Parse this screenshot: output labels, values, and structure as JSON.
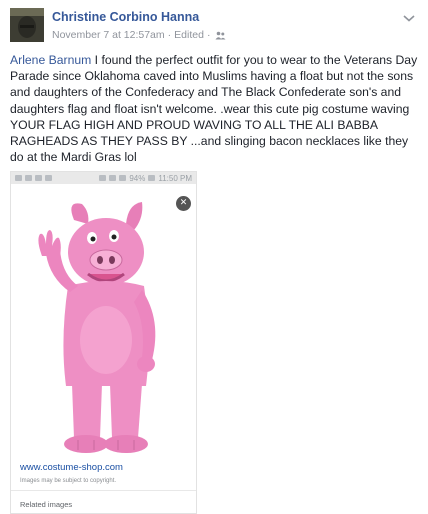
{
  "post": {
    "author": "Christine Corbino Hanna",
    "timestamp": "November 7 at 12:57am",
    "separator": "·",
    "edited": "Edited",
    "separator2": "·",
    "audience_icon": "friends-icon",
    "menu_icon": "chevron-down-icon"
  },
  "body": {
    "tag": "Arlene Barnum",
    "text": " I found the perfect outfit for you to wear to the Veterans Day Parade since Oklahoma caved into Muslims having a float but not the sons and daughters of the Confederacy and The Black Confederate son's and daughters flag and float isn't welcome. .wear this cute pig costume waving YOUR FLAG HIGH AND PROUD WAVING TO ALL THE ALI BABBA RAGHEADS AS THEY PASS BY ...and slinging bacon necklaces like they do at the Mardi Gras lol"
  },
  "screenshot": {
    "status_time": "11:50 PM",
    "battery": "94%",
    "close_glyph": "✕",
    "source_url": "www.costume-shop.com",
    "disclaimer": "Images may be subject to copyright.",
    "related": "Related images"
  },
  "colors": {
    "link": "#365899",
    "meta": "#90949c",
    "costume_pink": "#ee8fc4"
  }
}
